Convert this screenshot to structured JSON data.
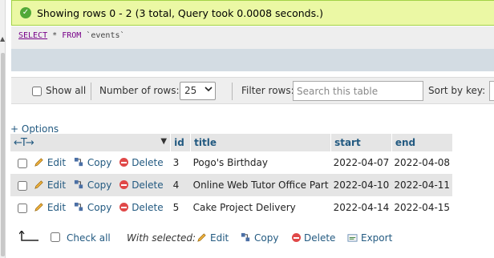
{
  "message": {
    "text": "Showing rows 0 - 2 (3 total, Query took 0.0008 seconds.)"
  },
  "sql": {
    "select": "SELECT",
    "star": "*",
    "from": "FROM",
    "table": "`events`"
  },
  "nav": {
    "show_all": "Show all",
    "number_of_rows_label": "Number of rows:",
    "number_of_rows_value": "25",
    "filter_label": "Filter rows:",
    "filter_placeholder": "Search this table",
    "sort_label": "Sort by key:"
  },
  "options_link": "+ Options",
  "table": {
    "arrows": "←T→",
    "columns": [
      "id",
      "title",
      "start",
      "end"
    ],
    "actions": {
      "edit": "Edit",
      "copy": "Copy",
      "delete": "Delete"
    },
    "rows": [
      {
        "id": "3",
        "title": "Pogo's Birthday",
        "start": "2022-04-07",
        "end": "2022-04-08"
      },
      {
        "id": "4",
        "title": "Online Web Tutor Office Part",
        "start": "2022-04-10",
        "end": "2022-04-11"
      },
      {
        "id": "5",
        "title": "Cake Project Delivery",
        "start": "2022-04-14",
        "end": "2022-04-15"
      }
    ]
  },
  "bottom": {
    "check_all": "Check all",
    "with_selected": "With selected:",
    "edit": "Edit",
    "copy": "Copy",
    "delete": "Delete",
    "export": "Export"
  },
  "colors": {
    "link": "#235a81",
    "success_bg": "#ebf8a4",
    "success_border": "#a2d246",
    "row_alt": "#e5e5e5"
  }
}
